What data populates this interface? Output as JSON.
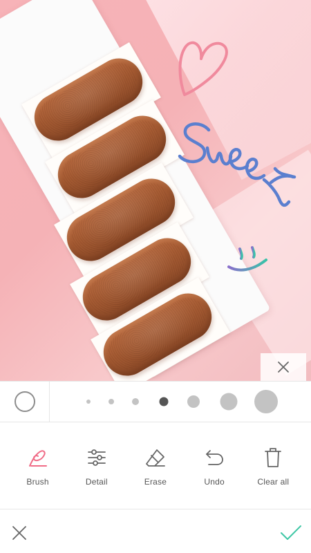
{
  "canvas": {
    "doodles": [
      "heart-doodle",
      "sweet-doodle",
      "smiley-doodle"
    ],
    "sweet_text": "Sweet",
    "colors": {
      "heart": "#f08a9d",
      "sweet": "#5b7fcf",
      "smile_left": "#8a6fcc",
      "smile_right": "#37c3a8"
    }
  },
  "brush_sizes": {
    "count": 7,
    "selected_index": 3,
    "selected_color": "#555555",
    "color": "#c3c3c3"
  },
  "tools": [
    {
      "id": "brush",
      "label": "Brush",
      "icon": "brush-icon",
      "active": true
    },
    {
      "id": "detail",
      "label": "Detail",
      "icon": "sliders-icon",
      "active": false
    },
    {
      "id": "erase",
      "label": "Erase",
      "icon": "eraser-icon",
      "active": false
    },
    {
      "id": "undo",
      "label": "Undo",
      "icon": "undo-icon",
      "active": false
    },
    {
      "id": "clear",
      "label": "Clear all",
      "icon": "trash-icon",
      "active": false
    }
  ],
  "actions": {
    "cancel_icon": "close-icon",
    "confirm_icon": "check-icon",
    "confirm_color": "#3ec7a5",
    "accent": "#f06b86"
  }
}
